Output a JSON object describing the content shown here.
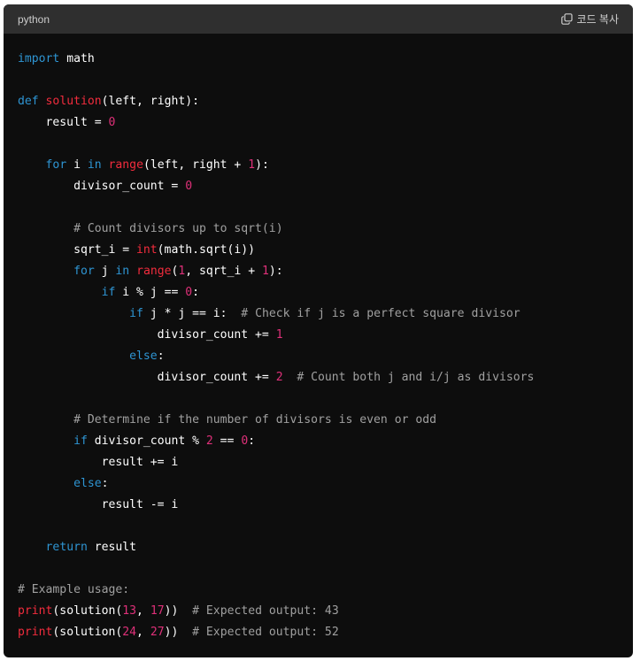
{
  "header": {
    "language": "python",
    "copy_label": "코드 복사"
  },
  "code_lines": [
    [
      {
        "t": "import",
        "c": "kw"
      },
      {
        "t": " math"
      }
    ],
    [],
    [
      {
        "t": "def",
        "c": "kw"
      },
      {
        "t": " "
      },
      {
        "t": "solution",
        "c": "fn"
      },
      {
        "t": "(left, right):"
      }
    ],
    [
      {
        "t": "    result = "
      },
      {
        "t": "0",
        "c": "num"
      }
    ],
    [],
    [
      {
        "t": "    "
      },
      {
        "t": "for",
        "c": "kw"
      },
      {
        "t": " i "
      },
      {
        "t": "in",
        "c": "kw"
      },
      {
        "t": " "
      },
      {
        "t": "range",
        "c": "fn"
      },
      {
        "t": "(left, right + "
      },
      {
        "t": "1",
        "c": "num"
      },
      {
        "t": "):"
      }
    ],
    [
      {
        "t": "        divisor_count = "
      },
      {
        "t": "0",
        "c": "num"
      }
    ],
    [],
    [
      {
        "t": "        "
      },
      {
        "t": "# Count divisors up to sqrt(i)",
        "c": "com"
      }
    ],
    [
      {
        "t": "        sqrt_i = "
      },
      {
        "t": "int",
        "c": "fn"
      },
      {
        "t": "(math.sqrt(i))"
      }
    ],
    [
      {
        "t": "        "
      },
      {
        "t": "for",
        "c": "kw"
      },
      {
        "t": " j "
      },
      {
        "t": "in",
        "c": "kw"
      },
      {
        "t": " "
      },
      {
        "t": "range",
        "c": "fn"
      },
      {
        "t": "("
      },
      {
        "t": "1",
        "c": "num"
      },
      {
        "t": ", sqrt_i + "
      },
      {
        "t": "1",
        "c": "num"
      },
      {
        "t": "):"
      }
    ],
    [
      {
        "t": "            "
      },
      {
        "t": "if",
        "c": "kw"
      },
      {
        "t": " i % j == "
      },
      {
        "t": "0",
        "c": "num"
      },
      {
        "t": ":"
      }
    ],
    [
      {
        "t": "                "
      },
      {
        "t": "if",
        "c": "kw"
      },
      {
        "t": " j * j == i:  "
      },
      {
        "t": "# Check if j is a perfect square divisor",
        "c": "com"
      }
    ],
    [
      {
        "t": "                    divisor_count += "
      },
      {
        "t": "1",
        "c": "num"
      }
    ],
    [
      {
        "t": "                "
      },
      {
        "t": "else",
        "c": "kw"
      },
      {
        "t": ":"
      }
    ],
    [
      {
        "t": "                    divisor_count += "
      },
      {
        "t": "2",
        "c": "num"
      },
      {
        "t": "  "
      },
      {
        "t": "# Count both j and i/j as divisors",
        "c": "com"
      }
    ],
    [],
    [
      {
        "t": "        "
      },
      {
        "t": "# Determine if the number of divisors is even or odd",
        "c": "com"
      }
    ],
    [
      {
        "t": "        "
      },
      {
        "t": "if",
        "c": "kw"
      },
      {
        "t": " divisor_count % "
      },
      {
        "t": "2",
        "c": "num"
      },
      {
        "t": " == "
      },
      {
        "t": "0",
        "c": "num"
      },
      {
        "t": ":"
      }
    ],
    [
      {
        "t": "            result += i"
      }
    ],
    [
      {
        "t": "        "
      },
      {
        "t": "else",
        "c": "kw"
      },
      {
        "t": ":"
      }
    ],
    [
      {
        "t": "            result -= i"
      }
    ],
    [],
    [
      {
        "t": "    "
      },
      {
        "t": "return",
        "c": "kw"
      },
      {
        "t": " result"
      }
    ],
    [],
    [
      {
        "t": "# Example usage:",
        "c": "com"
      }
    ],
    [
      {
        "t": "print",
        "c": "fn"
      },
      {
        "t": "(solution("
      },
      {
        "t": "13",
        "c": "num"
      },
      {
        "t": ", "
      },
      {
        "t": "17",
        "c": "num"
      },
      {
        "t": "))  "
      },
      {
        "t": "# Expected output: 43",
        "c": "com"
      }
    ],
    [
      {
        "t": "print",
        "c": "fn"
      },
      {
        "t": "(solution("
      },
      {
        "t": "24",
        "c": "num"
      },
      {
        "t": ", "
      },
      {
        "t": "27",
        "c": "num"
      },
      {
        "t": "))  "
      },
      {
        "t": "# Expected output: 52",
        "c": "com"
      }
    ]
  ]
}
